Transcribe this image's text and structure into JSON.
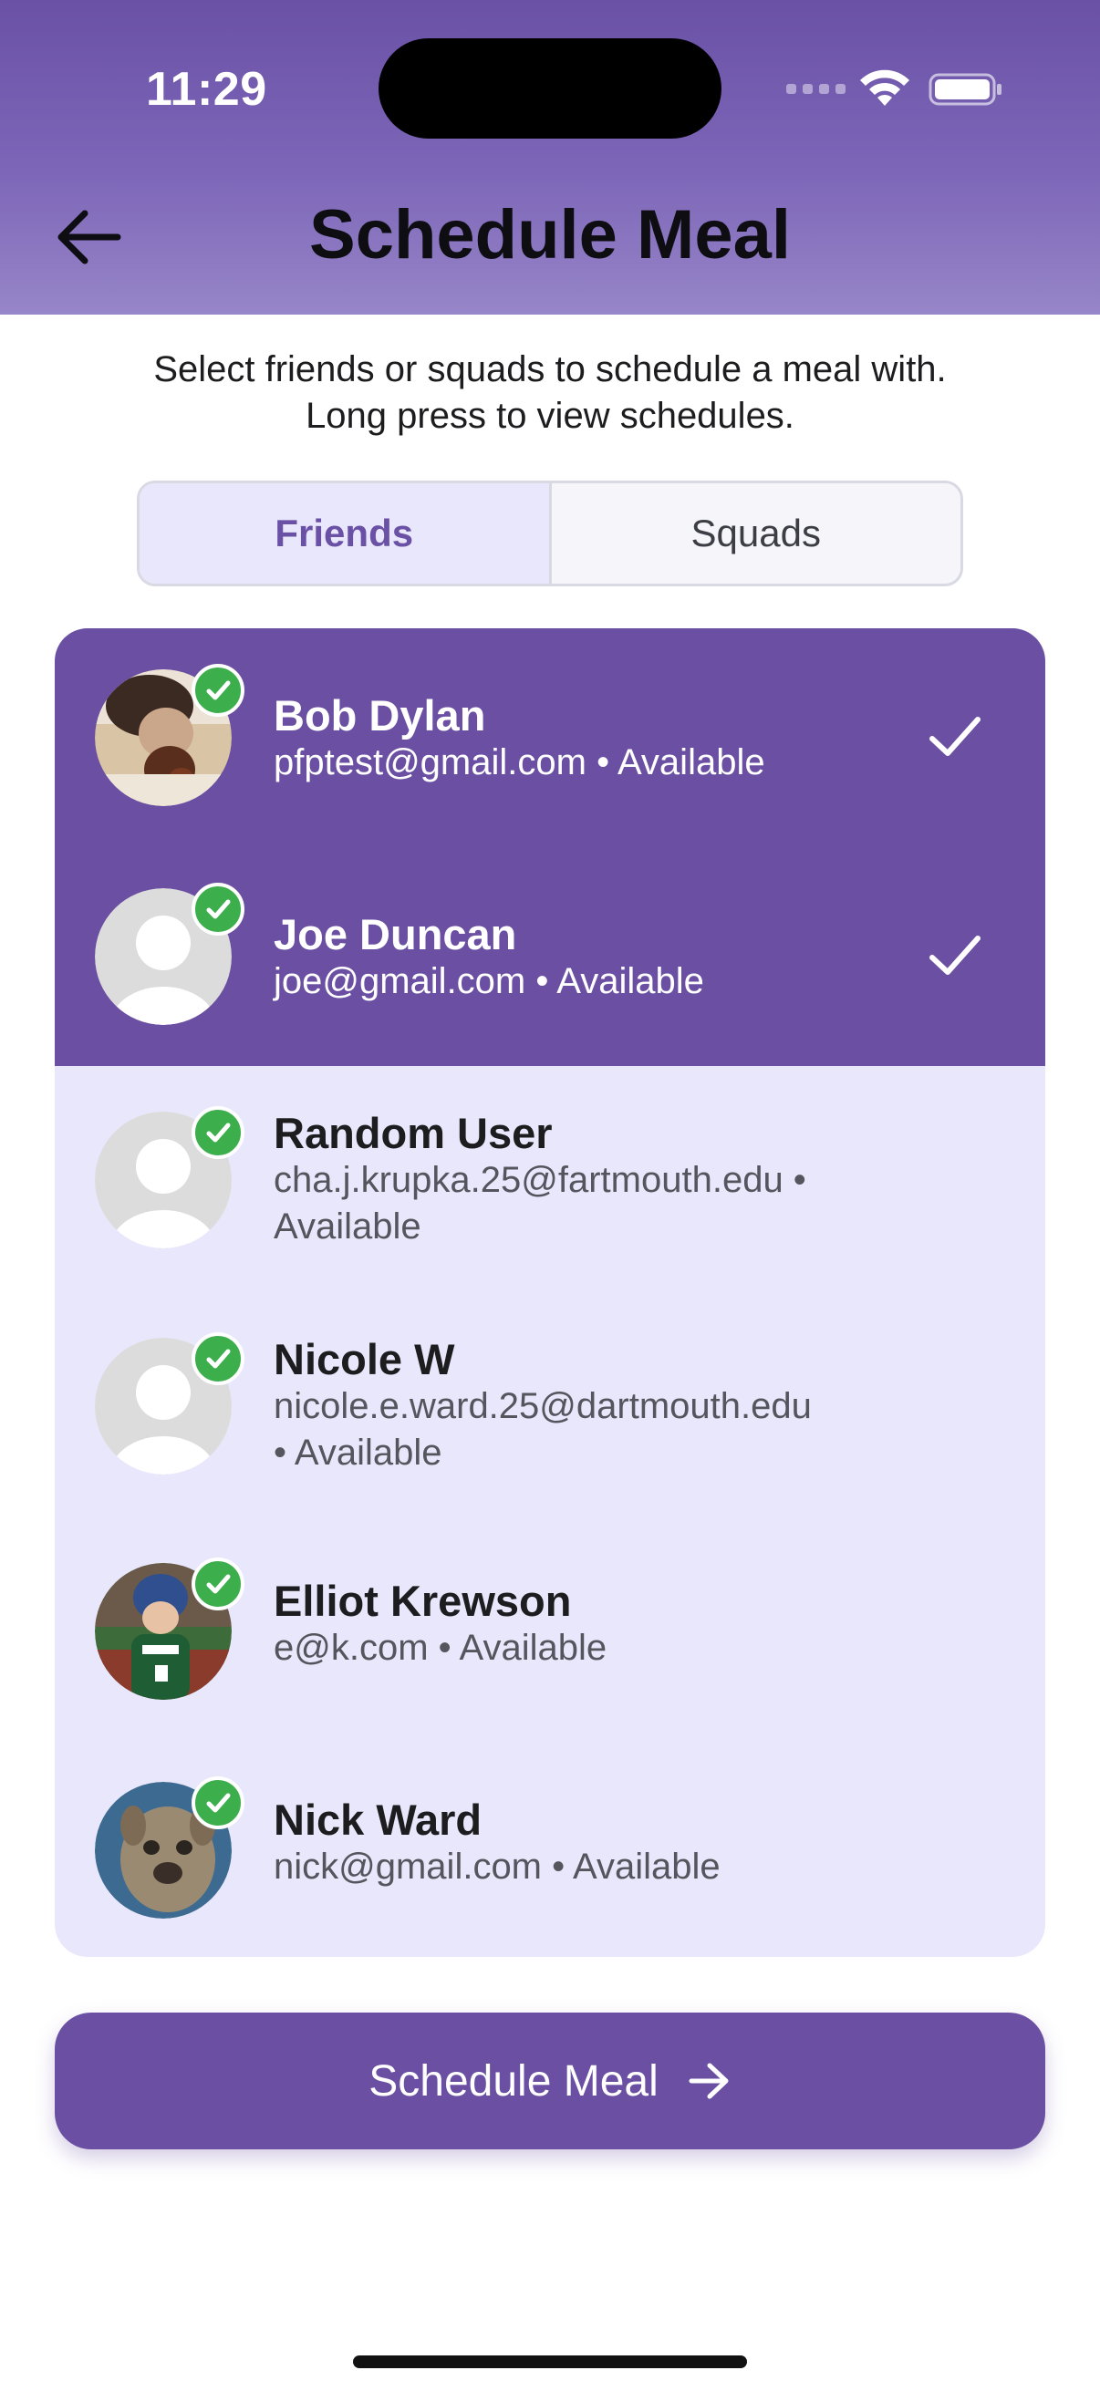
{
  "status_bar": {
    "time": "11:29"
  },
  "header": {
    "title": "Schedule Meal",
    "back_icon": "arrow-left-icon",
    "accent_color": "#6a51a6"
  },
  "subtitle": {
    "line1": "Select friends or squads to schedule a meal with.",
    "line2": "Long press to view schedules."
  },
  "tabs": [
    {
      "label": "Friends",
      "selected": true
    },
    {
      "label": "Squads",
      "selected": false
    }
  ],
  "friends": [
    {
      "name": "Bob Dylan",
      "line1": "pfptest@gmail.com • Available",
      "line2": "",
      "selected": true,
      "avatar": "photo-person-eating"
    },
    {
      "name": "Joe Duncan",
      "line1": "joe@gmail.com • Available",
      "line2": "",
      "selected": true,
      "avatar": "default-avatar"
    },
    {
      "name": "Random User",
      "line1": "cha.j.krupka.25@fartmouth.edu •",
      "line2": "Available",
      "selected": false,
      "avatar": "default-avatar"
    },
    {
      "name": "Nicole W",
      "line1": "nicole.e.ward.25@dartmouth.edu",
      "line2": "• Available",
      "selected": false,
      "avatar": "default-avatar"
    },
    {
      "name": "Elliot Krewson",
      "line1": "e@k.com • Available",
      "line2": "",
      "selected": false,
      "avatar": "photo-baseball-player"
    },
    {
      "name": "Nick Ward",
      "line1": "nick@gmail.com • Available",
      "line2": "",
      "selected": false,
      "avatar": "photo-dog"
    }
  ],
  "cta": {
    "label": "Schedule Meal",
    "icon": "arrow-right-icon"
  },
  "colors": {
    "selected_row": "#6a4fa3",
    "list_bg": "#e9e7fb",
    "badge": "#3cae4c"
  }
}
